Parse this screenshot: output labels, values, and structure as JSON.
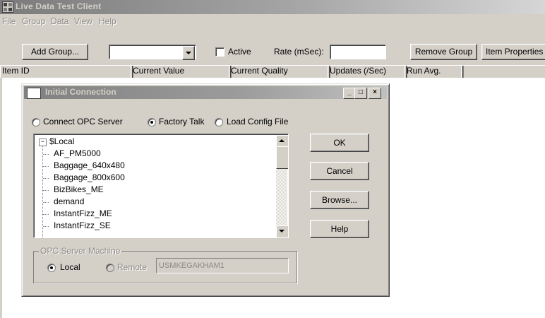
{
  "window": {
    "title": "Live Data Test Client"
  },
  "menu": [
    "File",
    "Group",
    "Data",
    "View",
    "Help"
  ],
  "toolbar": {
    "add_group": "Add Group...",
    "group_select_value": "",
    "active_label": "Active",
    "rate_label": "Rate (mSec):",
    "rate_value": "",
    "remove_group": "Remove Group",
    "item_properties": "Item Properties"
  },
  "columns": [
    "Item ID",
    "Current Value",
    "Current Quality",
    "Updates (/Sec)",
    "Run Avg."
  ],
  "dialog": {
    "title": "Initial Connection",
    "min_glyph": "_",
    "max_glyph": "□",
    "close_glyph": "×",
    "radio_options": [
      {
        "label": "Connect OPC Server",
        "selected": false
      },
      {
        "label": "Factory Talk",
        "selected": true
      },
      {
        "label": "Load Config File",
        "selected": false
      }
    ],
    "tree": {
      "root": "$Local",
      "expander": "⊟",
      "items": [
        "AF_PM5000",
        "Baggage_640x480",
        "Baggage_800x600",
        "BizBikes_ME",
        "demand",
        "InstantFizz_ME",
        "InstantFizz_SE"
      ]
    },
    "buttons": {
      "ok": "OK",
      "cancel": "Cancel",
      "browse": "Browse...",
      "help": "Help"
    },
    "server_group": {
      "label": "OPC Server Machine",
      "local": "Local",
      "remote": "Remote",
      "machine_name": "USMKEGAKHAM1"
    }
  }
}
